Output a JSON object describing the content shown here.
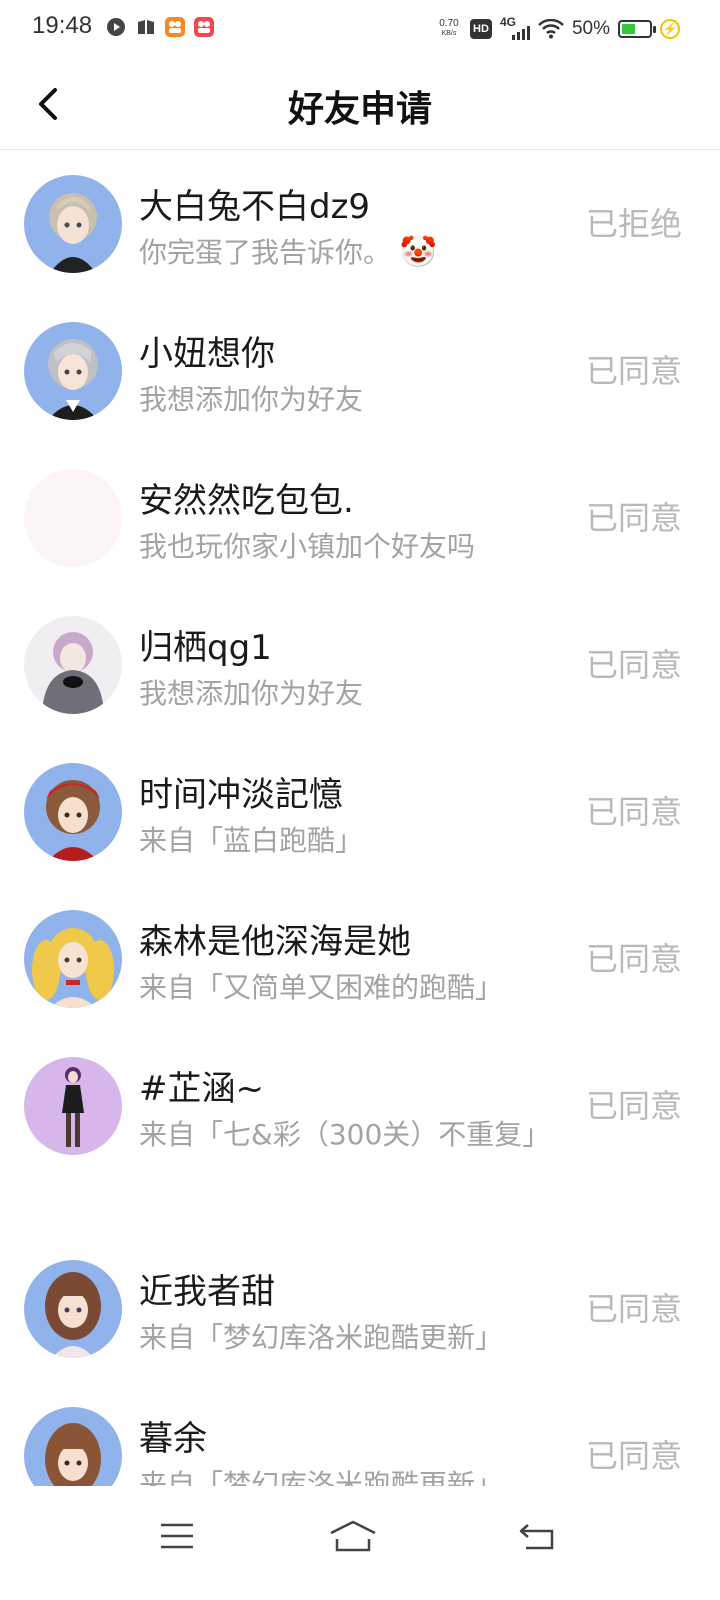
{
  "status_bar": {
    "time": "19:48",
    "net_speed_value": "0.70",
    "net_speed_unit": "KB/s",
    "hd": "HD",
    "network": "4G",
    "battery": "50%",
    "battery_level": 0.5,
    "app_icons": [
      "video-app-icon",
      "book-app-icon",
      "orange-app-icon",
      "red-app-icon"
    ]
  },
  "header": {
    "title": "好友申请",
    "back_icon": "chevron-left-icon"
  },
  "requests": [
    {
      "nickname": "大白兔不白dz9",
      "message": "你完蛋了我告诉你。",
      "emoji": "🤡",
      "status": "已拒绝"
    },
    {
      "nickname": "小妞想你",
      "message": "我想添加你为好友",
      "status": "已同意"
    },
    {
      "nickname": "安然然吃包包.",
      "message": "我也玩你家小镇加个好友吗",
      "status": "已同意"
    },
    {
      "nickname": "归栖qg1",
      "message": "我想添加你为好友",
      "status": "已同意"
    },
    {
      "nickname": "时间冲淡記憶",
      "message": "来自「蓝白跑酷」",
      "status": "已同意"
    },
    {
      "nickname": "森林是他深海是她",
      "message": "来自「又简单又困难的跑酷」",
      "status": "已同意"
    },
    {
      "nickname": "#芷涵~",
      "message": "来自「七&彩（300关）不重复」",
      "status": "已同意"
    },
    {
      "nickname": "近我者甜",
      "message": "来自「梦幻库洛米跑酷更新」",
      "status": "已同意"
    },
    {
      "nickname": "暮余",
      "message": "来自「梦幻库洛米跑酷更新」",
      "status": "已同意"
    }
  ],
  "nav_bar": {
    "icons": [
      "menu-icon",
      "home-icon",
      "back-icon"
    ]
  }
}
